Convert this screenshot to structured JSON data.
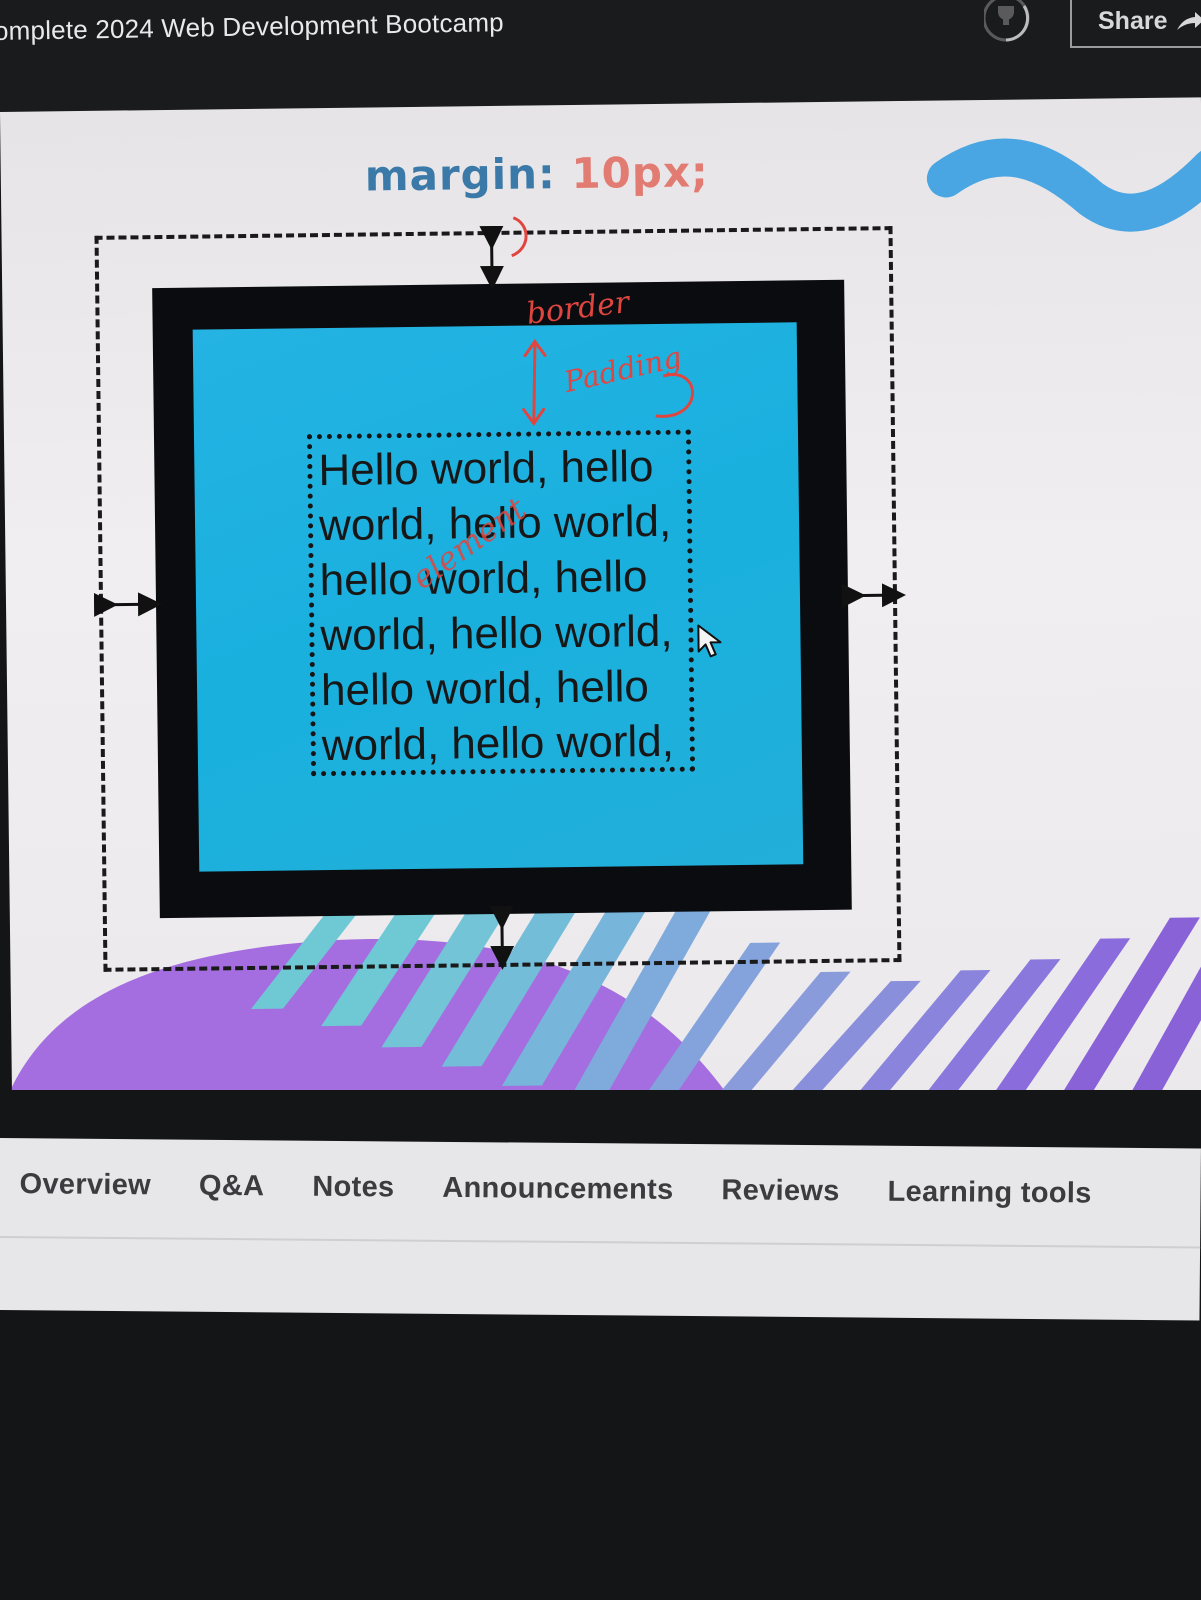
{
  "header": {
    "course_title": "omplete 2024 Web Development Bootcamp",
    "share_label": "Share",
    "trophy_icon": "trophy-icon",
    "share_icon": "share-arrow-icon"
  },
  "slide": {
    "margin_caption": {
      "property": "margin:",
      "value": "10px;"
    },
    "content_lines": [
      "Hello world, hello",
      "world, hello world,",
      "hello world, hello",
      "world, hello world,",
      "hello world, hello",
      "world, hello world,"
    ],
    "handwritten_notes": {
      "border": "border",
      "padding": "Padding",
      "element": "element"
    },
    "colors": {
      "margin_word": "#3b79a8",
      "margin_value": "#e27c73",
      "border": "#0b0c10",
      "padding": "#1eb1e0",
      "handwriting": "#e0463f",
      "stripes_teal": "#6ec8d6",
      "stripes_purple": "#8a62d8"
    }
  },
  "tabs": [
    {
      "label": "Overview"
    },
    {
      "label": "Q&A"
    },
    {
      "label": "Notes"
    },
    {
      "label": "Announcements"
    },
    {
      "label": "Reviews"
    },
    {
      "label": "Learning tools"
    }
  ]
}
